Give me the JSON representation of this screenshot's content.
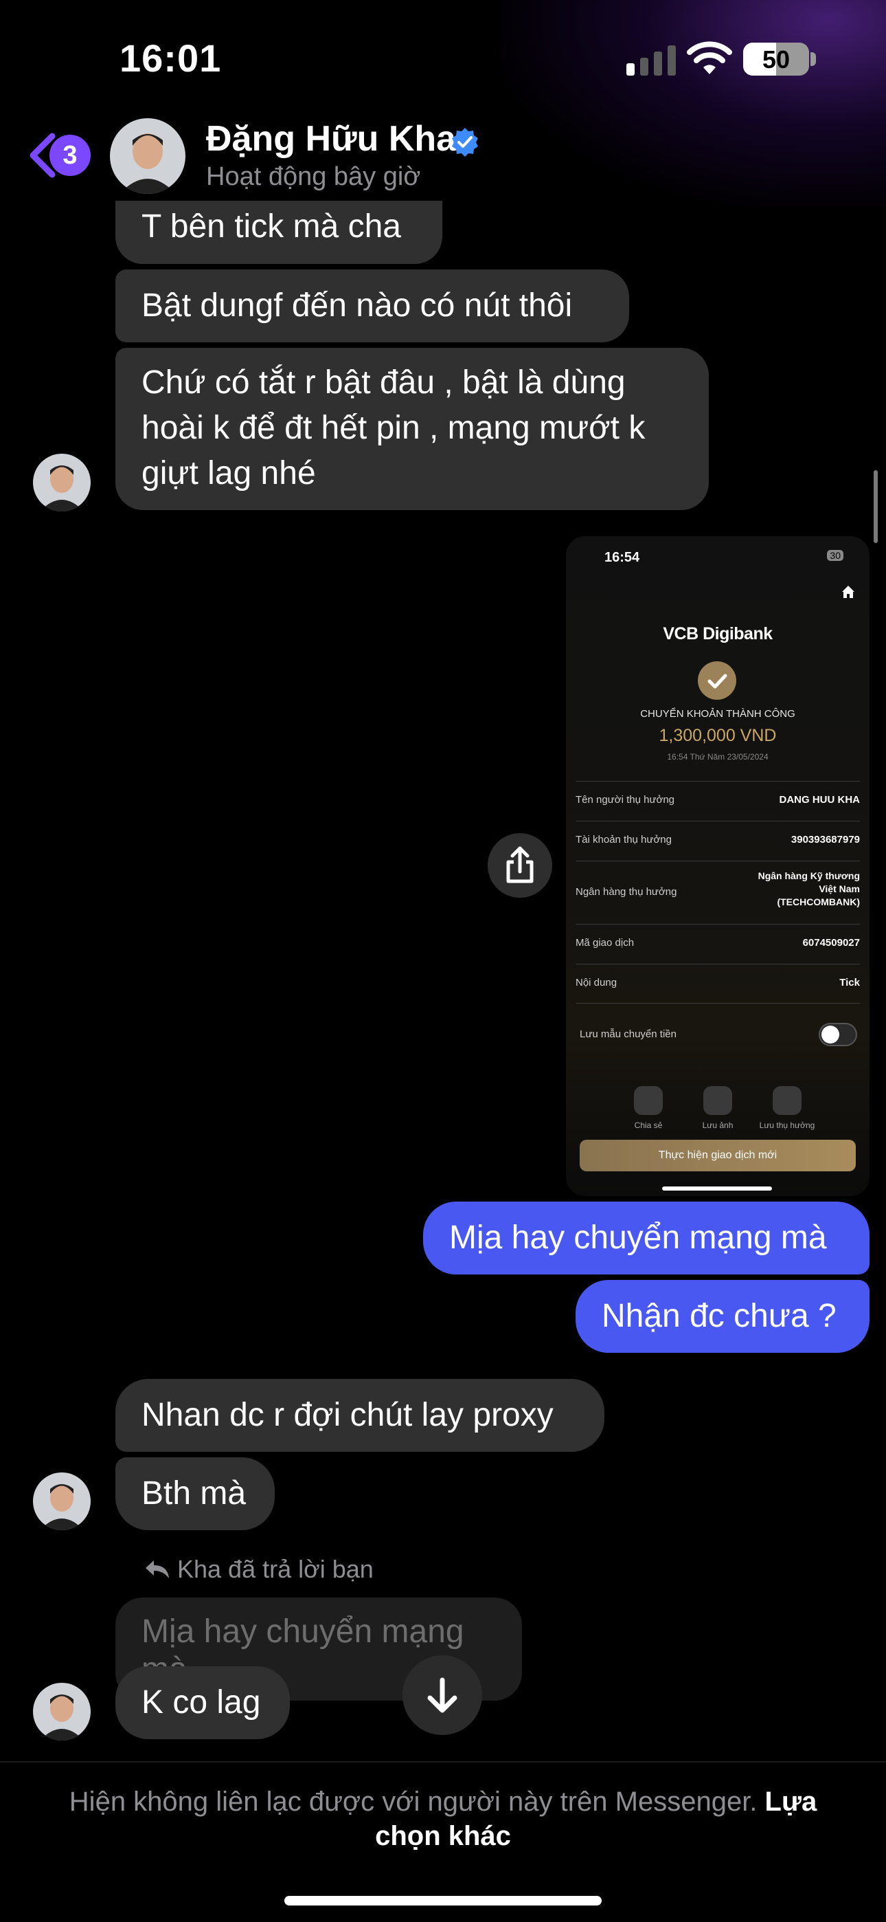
{
  "status_bar": {
    "time": "16:01",
    "battery": "50",
    "battery_level": 0.5
  },
  "header": {
    "back_badge": "3",
    "name": "Đặng Hữu Kha",
    "status": "Hoạt động bây giờ",
    "verified": true
  },
  "messages": [
    {
      "side": "in",
      "text": "T bên tick mà cha"
    },
    {
      "side": "in",
      "text": "Bật dungf đến nào có nút thôi"
    },
    {
      "side": "in",
      "lines": [
        "Chứ có tắt r bật đâu , bật là dùng",
        "hoài k để đt hết pin , mạng mướt k",
        "giựt lag nhé"
      ]
    },
    {
      "side": "out",
      "text": "Mịa hay chuyển mạng mà"
    },
    {
      "side": "out",
      "text": "Nhận đc chưa ?"
    },
    {
      "side": "in",
      "text": "Nhan dc r đợi chút lay proxy"
    },
    {
      "side": "in",
      "text": "Bth mà"
    },
    {
      "side": "in",
      "text": "K co lag"
    }
  ],
  "reply": {
    "label": "Kha đã trả lời bạn",
    "quoted": "Mịa hay chuyển mạng mà"
  },
  "receipt": {
    "time": "16:54",
    "battery": "30",
    "brand": "VCB Digibank",
    "title": "CHUYỂN KHOẢN THÀNH CÔNG",
    "amount": "1,300,000 VND",
    "datetime": "16:54 Thứ Năm 23/05/2024",
    "rows": [
      {
        "label": "Tên người thụ hưởng",
        "value": "DANG HUU KHA"
      },
      {
        "label": "Tài khoản thụ hưởng",
        "value": "390393687979"
      },
      {
        "label": "Ngân hàng thụ hưởng",
        "value_lines": [
          "Ngân hàng Kỹ thương",
          "Việt Nam",
          "(TECHCOMBANK)"
        ]
      },
      {
        "label": "Mã giao dịch",
        "value": "6074509027"
      },
      {
        "label": "Nội dung",
        "value": "Tick"
      }
    ],
    "save_template_label": "Lưu mẫu chuyển tiền",
    "actions": [
      "Chia sẻ",
      "Lưu ảnh",
      "Lưu thụ hưởng"
    ],
    "cta": "Thực hiện giao dịch mới"
  },
  "footer": {
    "text": "Hiện không liên lạc được với người này trên Messenger.",
    "link": "Lựa chọn khác"
  },
  "icons": [
    "back-chevron-icon",
    "verified-badge-icon",
    "share-icon",
    "arrow-down-icon",
    "home-icon",
    "check-icon",
    "reply-arrow-icon"
  ],
  "colors": {
    "outgoing_bubble": "#4a58f2",
    "incoming_bubble": "#303030",
    "badge": "#7b47ff",
    "verified": "#3d8bfd",
    "receipt_gold": "#c9a766"
  }
}
